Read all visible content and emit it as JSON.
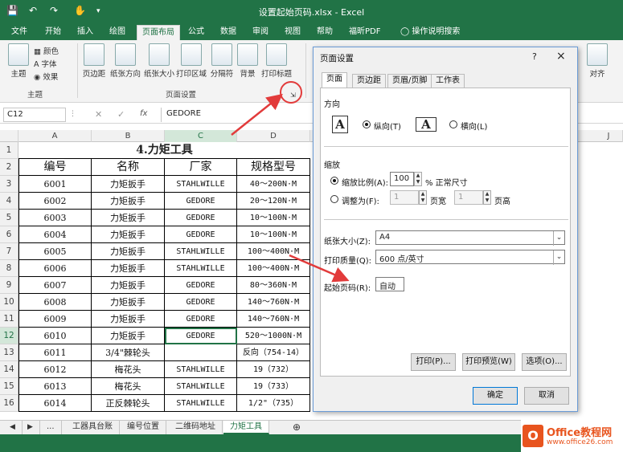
{
  "window": {
    "title": "设置起始页码.xlsx - Excel"
  },
  "tabs": [
    "文件",
    "开始",
    "插入",
    "绘图",
    "页面布局",
    "公式",
    "数据",
    "审阅",
    "视图",
    "帮助",
    "福昕PDF",
    "操作说明搜索"
  ],
  "active_tab": "页面布局",
  "ribbon": {
    "theme_group": {
      "main": "主题",
      "colors": "颜色",
      "fonts": "字体",
      "effects": "效果",
      "label": "主题"
    },
    "page_setup": [
      "页边距",
      "纸张方向",
      "纸张大小",
      "打印区域",
      "分隔符",
      "背景",
      "打印标题"
    ],
    "page_setup_label": "页面设置",
    "arrange": "对齐"
  },
  "formula_bar": {
    "name_box": "C12",
    "fx": "fx",
    "content": "GEDORE"
  },
  "columns": [
    "A",
    "B",
    "C",
    "D",
    "J"
  ],
  "selected_col": "C",
  "selected_row": "12",
  "sheet": {
    "title": "4.力矩工具",
    "header": [
      "编号",
      "名称",
      "厂家",
      "规格型号"
    ],
    "rows": [
      {
        "n": "3",
        "a": "6001",
        "b": "力矩扳手",
        "c": "STAHLWILLE",
        "d": "40～200N·M"
      },
      {
        "n": "4",
        "a": "6002",
        "b": "力矩扳手",
        "c": "GEDORE",
        "d": "20～120N·M"
      },
      {
        "n": "5",
        "a": "6003",
        "b": "力矩扳手",
        "c": "GEDORE",
        "d": "10～100N·M"
      },
      {
        "n": "6",
        "a": "6004",
        "b": "力矩扳手",
        "c": "GEDORE",
        "d": "10～100N·M"
      },
      {
        "n": "7",
        "a": "6005",
        "b": "力矩扳手",
        "c": "STAHLWILLE",
        "d": "100～400N·M"
      },
      {
        "n": "8",
        "a": "6006",
        "b": "力矩扳手",
        "c": "STAHLWILLE",
        "d": "100～400N·M"
      },
      {
        "n": "9",
        "a": "6007",
        "b": "力矩扳手",
        "c": "GEDORE",
        "d": "80～360N·M"
      },
      {
        "n": "10",
        "a": "6008",
        "b": "力矩扳手",
        "c": "GEDORE",
        "d": "140～760N·M"
      },
      {
        "n": "11",
        "a": "6009",
        "b": "力矩扳手",
        "c": "GEDORE",
        "d": "140～760N·M"
      },
      {
        "n": "12",
        "a": "6010",
        "b": "力矩扳手",
        "c": "GEDORE",
        "d": "520～1000N·M"
      },
      {
        "n": "13",
        "a": "6011",
        "b": "3/4\"棘轮头",
        "c": "",
        "d": "反向（754-14）"
      },
      {
        "n": "14",
        "a": "6012",
        "b": "梅花头",
        "c": "STAHLWILLE",
        "d": "19（732）"
      },
      {
        "n": "15",
        "a": "6013",
        "b": "梅花头",
        "c": "STAHLWILLE",
        "d": "19（733）"
      },
      {
        "n": "16",
        "a": "6014",
        "b": "正反棘轮头",
        "c": "STAHLWILLE",
        "d": "1/2\"（735）"
      }
    ]
  },
  "row_numbers": [
    "1",
    "2"
  ],
  "sheet_tabs": [
    "工器具台账",
    "编号位置",
    "二维码地址",
    "力矩工具"
  ],
  "active_sheet": "力矩工具",
  "dialog": {
    "title": "页面设置",
    "help": "?",
    "close": "×",
    "tabs": [
      "页面",
      "页边距",
      "页眉/页脚",
      "工作表"
    ],
    "active_tab": "页面",
    "orientation_label": "方向",
    "portrait": "纵向(T)",
    "landscape": "横向(L)",
    "scaling_label": "缩放",
    "scale_ratio": "缩放比例(A):",
    "scale_value": "100",
    "scale_unit": "% 正常尺寸",
    "fit_to": "调整为(F):",
    "fit_wide_value": "1",
    "fit_wide": "页宽",
    "fit_tall_value": "1",
    "fit_tall": "页高",
    "paper_size_label": "纸张大小(Z):",
    "paper_size": "A4",
    "print_quality_label": "打印质量(Q):",
    "print_quality": "600 点/英寸",
    "first_page_label": "起始页码(R):",
    "first_page": "自动",
    "print_btn": "打印(P)...",
    "preview_btn": "打印预览(W)",
    "options_btn": "选项(O)...",
    "ok_btn": "确定",
    "cancel_btn": "取消"
  },
  "logo": {
    "brand": "Office教程网",
    "url": "www.office26.com"
  },
  "colors": {
    "excel_green": "#217346",
    "annotation_red": "#e23b3b",
    "logo_orange": "#e8541e"
  }
}
